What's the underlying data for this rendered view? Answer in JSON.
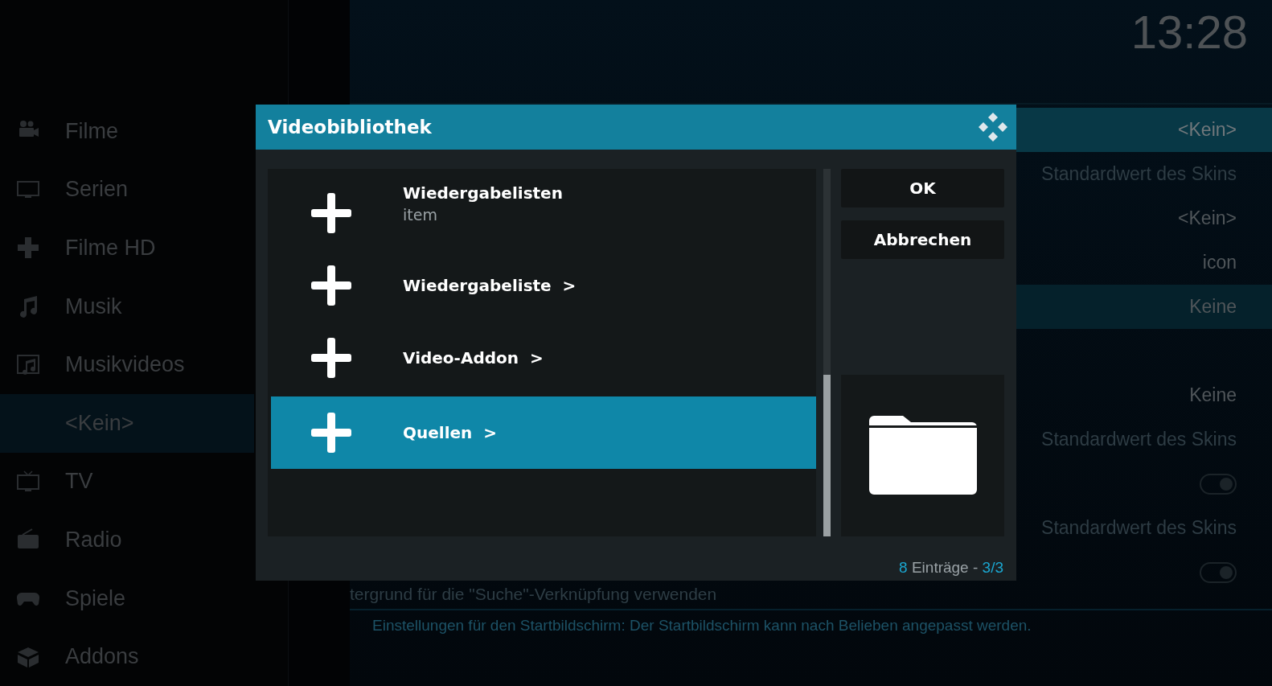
{
  "clock": "13:28",
  "sidebar": {
    "items": [
      {
        "label": "Filme",
        "selected": false
      },
      {
        "label": "Serien",
        "selected": false
      },
      {
        "label": "Filme HD",
        "selected": false
      },
      {
        "label": "Musik",
        "selected": false
      },
      {
        "label": "Musikvideos",
        "selected": false
      },
      {
        "label": "<Kein>",
        "selected": true
      },
      {
        "label": "TV",
        "selected": false
      },
      {
        "label": "Radio",
        "selected": false
      },
      {
        "label": "Spiele",
        "selected": false
      },
      {
        "label": "Addons",
        "selected": false
      }
    ]
  },
  "settings": {
    "rows": [
      {
        "value": "<Kein>",
        "selected": true
      },
      {
        "value": "Standardwert des Skins",
        "selected": false
      },
      {
        "value": "<Kein>",
        "selected": false
      },
      {
        "value": "icon",
        "selected": false
      },
      {
        "value": "Keine",
        "selected": false,
        "highlighted": true
      },
      {
        "value": "Keine",
        "selected": false
      },
      {
        "value": "Standardwert des Skins",
        "selected": false
      },
      {
        "selected": false,
        "toggle_on": true
      },
      {
        "value": "Standardwert des Skins",
        "selected": false
      },
      {
        "selected": false,
        "toggle_on": true
      }
    ],
    "partial_label": "tergrund für die \"Suche\"-Verknüpfung verwenden",
    "description": "Einstellungen für den Startbildschirm: Der Startbildschirm kann nach Belieben angepasst werden."
  },
  "dialog": {
    "title": "Videobibliothek",
    "items": [
      {
        "label": "Wiedergabelisten",
        "sublabel": "item",
        "selected": false
      },
      {
        "label": "Wiedergabeliste  >",
        "selected": false
      },
      {
        "label": "Video-Addon  >",
        "selected": false
      },
      {
        "label": "Quellen  >",
        "selected": true
      }
    ],
    "buttons": [
      "OK",
      "Abbrechen"
    ],
    "footer": {
      "count": "8",
      "text": " Einträge - ",
      "page": "3/3"
    }
  }
}
